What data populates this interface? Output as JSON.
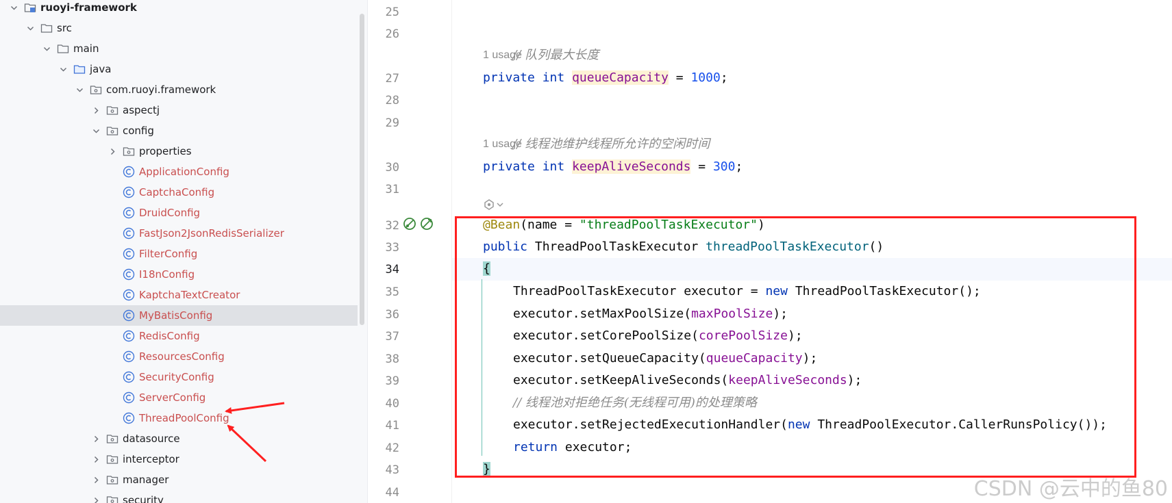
{
  "tree": {
    "items": [
      {
        "label": "ruoyi-framework",
        "icon": "module-folder-icon",
        "bold": true,
        "chevron": "down",
        "depth": 0
      },
      {
        "label": "src",
        "icon": "folder-icon",
        "chevron": "down",
        "depth": 1
      },
      {
        "label": "main",
        "icon": "folder-icon",
        "chevron": "down",
        "depth": 2
      },
      {
        "label": "java",
        "icon": "source-folder-icon",
        "chevron": "down",
        "depth": 3
      },
      {
        "label": "com.ruoyi.framework",
        "icon": "package-icon",
        "chevron": "down",
        "depth": 4
      },
      {
        "label": "aspectj",
        "icon": "package-icon",
        "chevron": "right",
        "depth": 5
      },
      {
        "label": "config",
        "icon": "package-icon",
        "chevron": "down",
        "depth": 5
      },
      {
        "label": "properties",
        "icon": "package-icon",
        "chevron": "right",
        "depth": 6
      },
      {
        "label": "ApplicationConfig",
        "icon": "class-icon",
        "chevron": "none",
        "depth": 6
      },
      {
        "label": "CaptchaConfig",
        "icon": "class-icon",
        "chevron": "none",
        "depth": 6
      },
      {
        "label": "DruidConfig",
        "icon": "class-icon",
        "chevron": "none",
        "depth": 6
      },
      {
        "label": "FastJson2JsonRedisSerializer",
        "icon": "class-icon",
        "chevron": "none",
        "depth": 6
      },
      {
        "label": "FilterConfig",
        "icon": "class-icon",
        "chevron": "none",
        "depth": 6
      },
      {
        "label": "I18nConfig",
        "icon": "class-icon",
        "chevron": "none",
        "depth": 6
      },
      {
        "label": "KaptchaTextCreator",
        "icon": "class-icon",
        "chevron": "none",
        "depth": 6
      },
      {
        "label": "MyBatisConfig",
        "icon": "class-icon",
        "chevron": "none",
        "depth": 6,
        "selected": true
      },
      {
        "label": "RedisConfig",
        "icon": "class-icon",
        "chevron": "none",
        "depth": 6
      },
      {
        "label": "ResourcesConfig",
        "icon": "class-icon",
        "chevron": "none",
        "depth": 6
      },
      {
        "label": "SecurityConfig",
        "icon": "class-icon",
        "chevron": "none",
        "depth": 6
      },
      {
        "label": "ServerConfig",
        "icon": "class-icon",
        "chevron": "none",
        "depth": 6
      },
      {
        "label": "ThreadPoolConfig",
        "icon": "class-icon",
        "chevron": "none",
        "depth": 6
      },
      {
        "label": "datasource",
        "icon": "package-icon",
        "chevron": "right",
        "depth": 5
      },
      {
        "label": "interceptor",
        "icon": "package-icon",
        "chevron": "right",
        "depth": 5
      },
      {
        "label": "manager",
        "icon": "package-icon",
        "chevron": "right",
        "depth": 5
      },
      {
        "label": "security",
        "icon": "package-icon",
        "chevron": "right",
        "depth": 5
      }
    ]
  },
  "editor": {
    "line_numbers": [
      "25",
      "26",
      "27",
      "28",
      "29",
      "30",
      "31",
      "32",
      "33",
      "34",
      "35",
      "36",
      "37",
      "38",
      "39",
      "40",
      "41",
      "42",
      "43",
      "44"
    ],
    "current_line": "34",
    "usage_hints": [
      "1 usage",
      "1 usage"
    ],
    "code": {
      "l26_comment": "// 队列最大长度",
      "l27_kw1": "private",
      "l27_kw2": "int",
      "l27_field": "queueCapacity",
      "l27_eq": " = ",
      "l27_num": "1000",
      "l27_end": ";",
      "l29_comment": "// 线程池维护线程所允许的空闲时间",
      "l30_kw1": "private",
      "l30_kw2": "int",
      "l30_field": "keepAliveSeconds",
      "l30_eq": " = ",
      "l30_num": "300",
      "l30_end": ";",
      "l32_ann": "@Bean",
      "l32_open": "(name = ",
      "l32_str": "\"threadPoolTaskExecutor\"",
      "l32_close": ")",
      "l33_kw": "public",
      "l33_type": " ThreadPoolTaskExecutor ",
      "l33_method": "threadPoolTaskExecutor",
      "l33_parens": "()",
      "l34_brace": "{",
      "l35_a": "ThreadPoolTaskExecutor executor = ",
      "l35_kw": "new",
      "l35_b": " ThreadPoolTaskExecutor();",
      "l36_a": "executor.setMaxPoolSize(",
      "l36_f": "maxPoolSize",
      "l36_b": ");",
      "l37_a": "executor.setCorePoolSize(",
      "l37_f": "corePoolSize",
      "l37_b": ");",
      "l38_a": "executor.setQueueCapacity(",
      "l38_f": "queueCapacity",
      "l38_b": ");",
      "l39_a": "executor.setKeepAliveSeconds(",
      "l39_f": "keepAliveSeconds",
      "l39_b": ");",
      "l40_comment": "// 线程池对拒绝任务(无线程可用)的处理策略",
      "l41_a": "executor.setRejectedExecutionHandler(",
      "l41_kw": "new",
      "l41_b": " ThreadPoolExecutor.CallerRunsPolicy());",
      "l42_kw": "return",
      "l42_b": " executor;",
      "l43_brace": "}"
    }
  },
  "watermark": "CSDN @云中的鱼80",
  "colors": {
    "class_label": "#c94f4f",
    "keyword": "#0033b3",
    "field": "#871094",
    "string": "#067d17",
    "annotation": "#9e880d",
    "comment": "#8c8c8c",
    "selection_box": "#ff1f1f"
  }
}
